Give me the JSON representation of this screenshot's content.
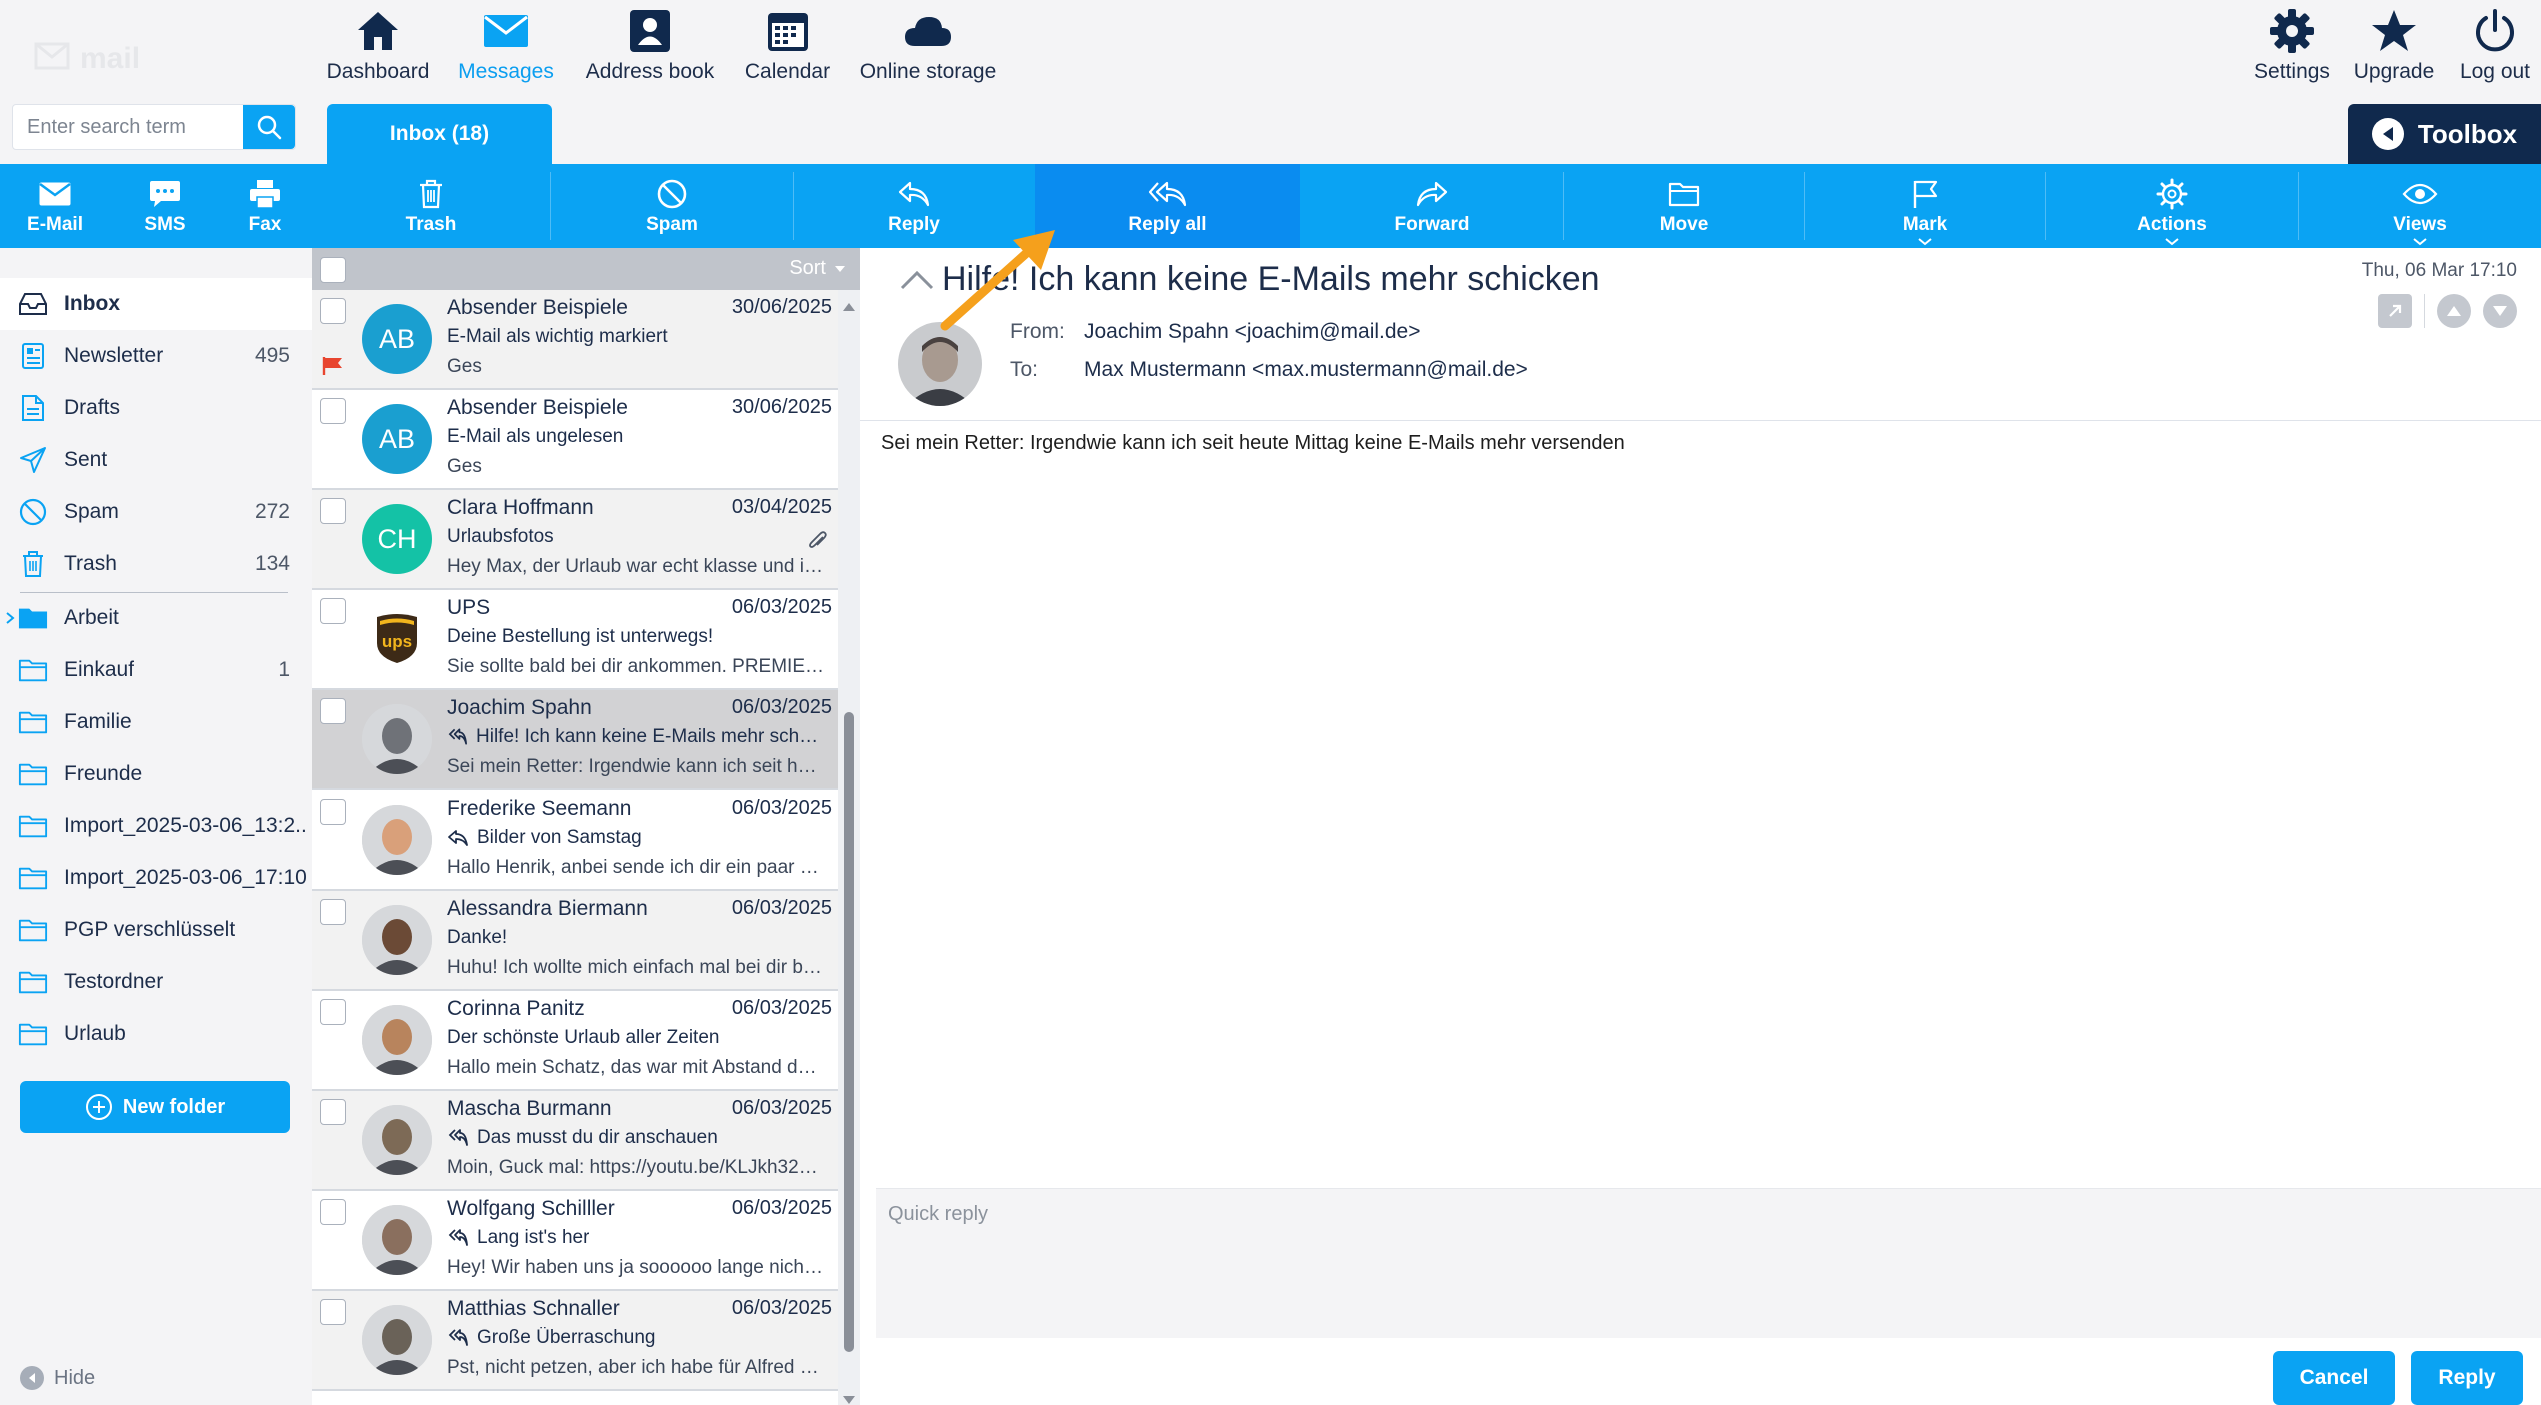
{
  "nav": {
    "items": [
      {
        "label": "Dashboard",
        "icon": "home-icon"
      },
      {
        "label": "Messages",
        "icon": "envelope-icon",
        "active": true
      },
      {
        "label": "Address book",
        "icon": "contact-icon"
      },
      {
        "label": "Calendar",
        "icon": "calendar-icon"
      },
      {
        "label": "Online storage",
        "icon": "cloud-icon"
      }
    ],
    "right": [
      {
        "label": "Settings",
        "icon": "gear-icon"
      },
      {
        "label": "Upgrade",
        "icon": "star-icon"
      },
      {
        "label": "Log out",
        "icon": "power-icon"
      }
    ]
  },
  "search": {
    "placeholder": "Enter search term"
  },
  "tab": {
    "label": "Inbox (18)"
  },
  "toolbox": {
    "label": "Toolbox"
  },
  "toolbar": {
    "compose": [
      {
        "label": "E-Mail",
        "icon": "envelope-icon"
      },
      {
        "label": "SMS",
        "icon": "sms-icon"
      },
      {
        "label": "Fax",
        "icon": "printer-icon"
      }
    ],
    "actions": [
      {
        "label": "Trash",
        "icon": "trash-icon"
      },
      {
        "label": "Spam",
        "icon": "block-icon"
      },
      {
        "label": "Reply",
        "icon": "reply-icon"
      },
      {
        "label": "Reply all",
        "icon": "reply-all-icon",
        "active": true
      },
      {
        "label": "Forward",
        "icon": "forward-icon"
      },
      {
        "label": "Move",
        "icon": "folder-icon"
      },
      {
        "label": "Mark",
        "icon": "flag-icon",
        "dropdown": true
      },
      {
        "label": "Actions",
        "icon": "gear-icon",
        "dropdown": true
      },
      {
        "label": "Views",
        "icon": "eye-icon",
        "dropdown": true
      }
    ]
  },
  "sidebar": {
    "folders": [
      {
        "label": "Inbox",
        "count": "",
        "icon": "inbox-icon",
        "active": true
      },
      {
        "label": "Newsletter",
        "count": "495",
        "icon": "newsletter-icon"
      },
      {
        "label": "Drafts",
        "count": "",
        "icon": "draft-icon"
      },
      {
        "label": "Sent",
        "count": "",
        "icon": "send-icon"
      },
      {
        "label": "Spam",
        "count": "272",
        "icon": "block-icon"
      },
      {
        "label": "Trash",
        "count": "134",
        "icon": "trash-icon"
      }
    ],
    "custom": [
      {
        "label": "Arbeit",
        "count": "",
        "expandable": true,
        "filled": true
      },
      {
        "label": "Einkauf",
        "count": "1"
      },
      {
        "label": "Familie",
        "count": ""
      },
      {
        "label": "Freunde",
        "count": ""
      },
      {
        "label": "Import_2025-03-06_13:2...",
        "count": ""
      },
      {
        "label": "Import_2025-03-06_17:10...",
        "count": ""
      },
      {
        "label": "PGP verschlüsselt",
        "count": ""
      },
      {
        "label": "Testordner",
        "count": ""
      },
      {
        "label": "Urlaub",
        "count": ""
      }
    ],
    "new_folder": "New folder",
    "hide": "Hide"
  },
  "list": {
    "sort_label": "Sort",
    "messages": [
      {
        "sender": "Absender Beispiele",
        "date": "30/06/2025",
        "subject": "E-Mail als wichtig markiert",
        "preview": "Ges",
        "initials": "AB",
        "avatar_color": "#1a9fd0",
        "flag": true,
        "style": "gray"
      },
      {
        "sender": "Absender Beispiele",
        "date": "30/06/2025",
        "subject": "E-Mail als ungelesen",
        "preview": "Ges",
        "initials": "AB",
        "avatar_color": "#1a9fd0",
        "style": "white"
      },
      {
        "sender": "Clara Hoffmann",
        "date": "03/04/2025",
        "subject": "Urlaubsfotos",
        "preview": "Hey Max, der Urlaub war echt klasse und ich...",
        "initials": "CH",
        "avatar_color": "#14c2a6",
        "attachment": true,
        "style": "gray"
      },
      {
        "sender": "UPS",
        "date": "06/03/2025",
        "subject": "Deine Bestellung ist unterwegs!",
        "preview": "Sie sollte bald bei dir ankommen. PREMIER-...",
        "initials": "ups",
        "avatar_color": "#ffffff",
        "logo": true,
        "style": "white"
      },
      {
        "sender": "Joachim Spahn",
        "date": "06/03/2025",
        "subject": "Hilfe! Ich kann keine E-Mails mehr schick...",
        "preview": "Sei mein Retter: Irgendwie kann ich seit heut...",
        "photo": "#6f7278",
        "status": "replied-all",
        "style": "selected"
      },
      {
        "sender": "Frederike Seemann",
        "date": "06/03/2025",
        "subject": "Bilder von Samstag",
        "preview": "Hallo Henrik, anbei sende ich dir ein paar Bil...",
        "photo": "#d9a07a",
        "status": "replied",
        "style": "white"
      },
      {
        "sender": "Alessandra Biermann",
        "date": "06/03/2025",
        "subject": "Danke!",
        "preview": "Huhu! Ich wollte mich einfach mal bei dir be...",
        "photo": "#6b4a36",
        "style": "gray"
      },
      {
        "sender": "Corinna Panitz",
        "date": "06/03/2025",
        "subject": "Der schönste Urlaub aller Zeiten",
        "preview": "Hallo mein Schatz, das war mit Abstand der ...",
        "photo": "#b8845d",
        "style": "white"
      },
      {
        "sender": "Mascha Burmann",
        "date": "06/03/2025",
        "subject": "Das musst du dir anschauen",
        "preview": "Moin, Guck mal: https://youtu.be/KLJkh324j...",
        "photo": "#7d6a56",
        "status": "replied-all",
        "style": "gray"
      },
      {
        "sender": "Wolfgang Schilller",
        "date": "06/03/2025",
        "subject": "Lang ist's her",
        "preview": "Hey! Wir haben uns ja soooooo lange nicht ...",
        "photo": "#8a6f5e",
        "status": "replied-all",
        "style": "white"
      },
      {
        "sender": "Matthias Schnaller",
        "date": "06/03/2025",
        "subject": "Große Überraschung",
        "preview": "Pst, nicht petzen, aber ich habe für Alfred m...",
        "photo": "#6a6258",
        "status": "replied-all",
        "style": "gray"
      }
    ]
  },
  "reader": {
    "subject": "Hilfe! Ich kann keine E-Mails mehr schicken",
    "date": "Thu, 06 Mar 17:10",
    "from_label": "From:",
    "from": "Joachim Spahn <joachim@mail.de>",
    "to_label": "To:",
    "to": "Max Mustermann <max.mustermann@mail.de>",
    "body": "Sei mein Retter: Irgendwie kann ich seit heute Mittag keine E-Mails mehr versenden",
    "quick_reply_placeholder": "Quick reply",
    "cancel": "Cancel",
    "reply": "Reply"
  },
  "colors": {
    "accent": "#0aa3f3",
    "accent_active": "#0a8cf0",
    "navy": "#10294d",
    "text": "#1d2d4a",
    "annotation_arrow": "#f5a01c"
  }
}
